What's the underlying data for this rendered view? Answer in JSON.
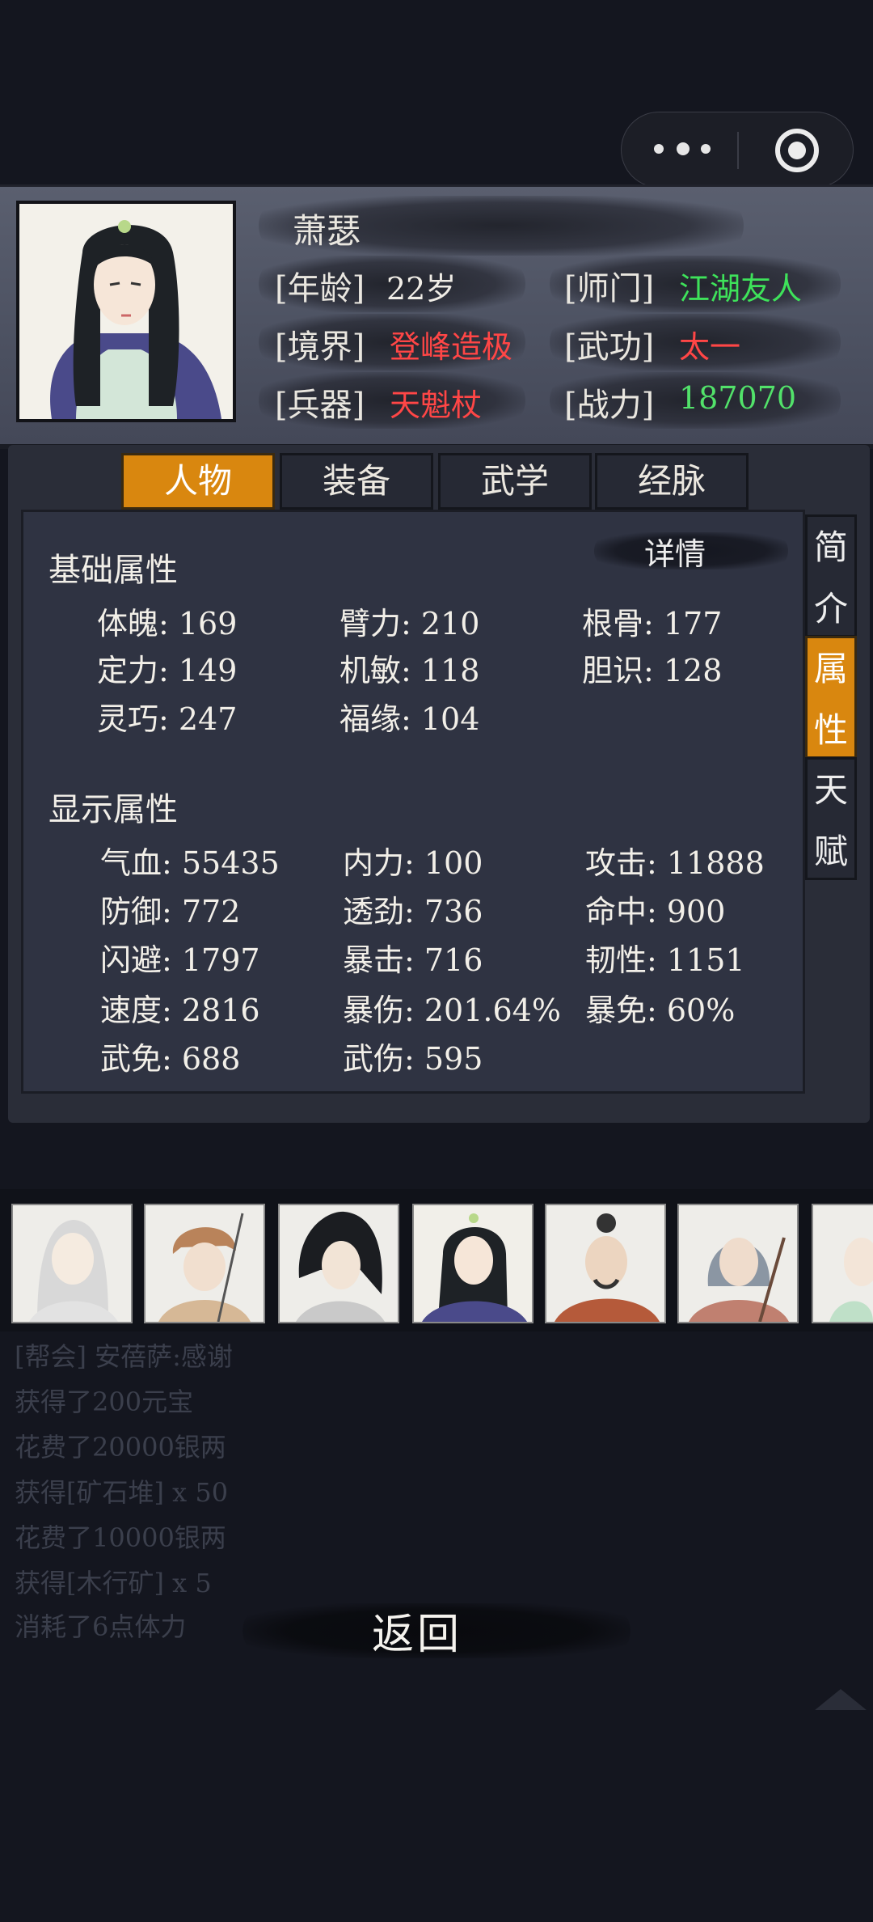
{
  "header": {
    "name": "萧瑟",
    "rows": [
      {
        "l_label": "[年龄]",
        "l_value": "22岁",
        "r_label": "[师门]",
        "r_value": "江湖友人"
      },
      {
        "l_label": "[境界]",
        "l_value": "登峰造极",
        "r_label": "[武功]",
        "r_value": "太一"
      },
      {
        "l_label": "[兵器]",
        "l_value": "天魁杖",
        "r_label": "[战力]",
        "r_value": "187070"
      }
    ]
  },
  "tabs": [
    "人物",
    "装备",
    "武学",
    "经脉"
  ],
  "active_tab": "人物",
  "side_tabs": [
    {
      "chars": [
        "简",
        "介"
      ]
    },
    {
      "chars": [
        "属",
        "性"
      ]
    },
    {
      "chars": [
        "天",
        "赋"
      ]
    }
  ],
  "detail_label": "详情",
  "basic": {
    "title": "基础属性",
    "stats": [
      "体魄: 169",
      "臂力: 210",
      "根骨: 177",
      "定力: 149",
      "机敏: 118",
      "胆识: 128",
      "灵巧: 247",
      "福缘: 104"
    ]
  },
  "display": {
    "title": "显示属性",
    "stats": [
      "气血: 55435",
      "内力: 100",
      "攻击: 11888",
      "防御: 772",
      "透劲: 736",
      "命中: 900",
      "闪避: 1797",
      "暴击: 716",
      "韧性: 1151",
      "速度: 2816",
      "暴伤: 201.64%",
      "暴免: 60%",
      "武免: 688",
      "武伤: 595"
    ]
  },
  "log": [
    "[帮会] 安蓓萨:感谢",
    "获得了200元宝",
    "花费了20000银两",
    "获得[矿石堆] x 50",
    "花费了10000银两",
    "获得[木行矿] x 5",
    "消耗了6点体力"
  ],
  "back_label": "返回",
  "colors": {
    "accent_orange": "#d9870f",
    "realm_red": "#ff4646",
    "sect_green": "#3ee25a"
  }
}
